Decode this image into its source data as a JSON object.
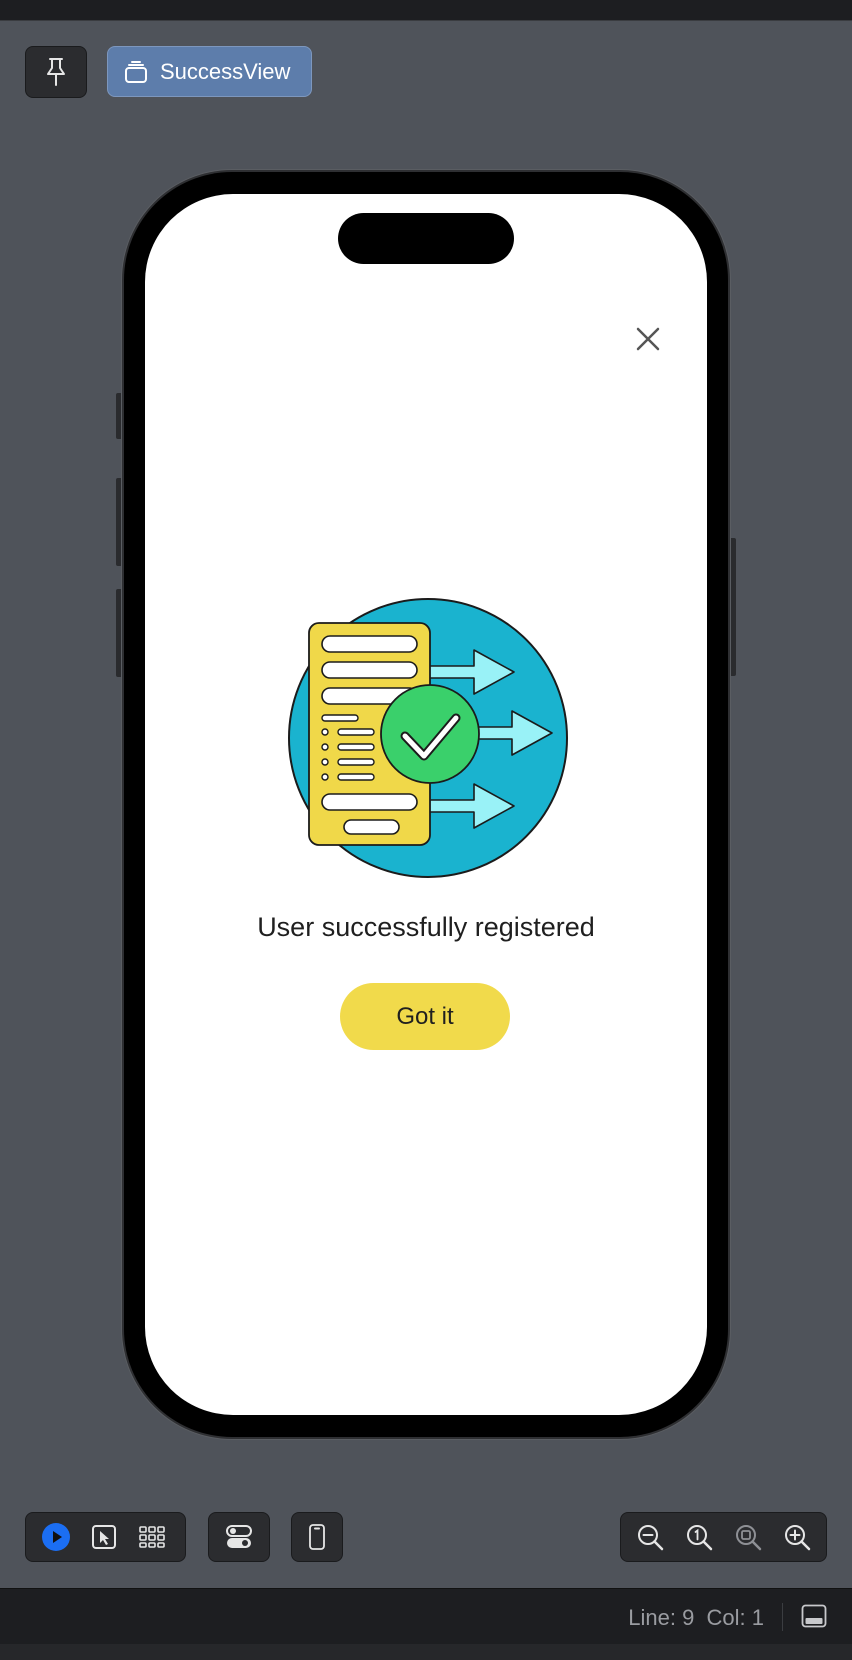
{
  "toolbar": {
    "pin": {
      "icon": "pin-icon"
    },
    "view_button": {
      "label": "SuccessView",
      "icon": "stack-icon"
    }
  },
  "preview": {
    "close_icon": "close-icon",
    "illustration": "document-checkmark-illustration",
    "message": "User successfully registered",
    "button_label": "Got it",
    "colors": {
      "button": "#f1da4b",
      "circle": "#1ab3cf",
      "arrow": "#99f2f7",
      "document": "#f0d849",
      "check": "#3ad06b"
    }
  },
  "bottom_toolbar": {
    "left_group": [
      "play-icon",
      "select-icon",
      "grid-icon"
    ],
    "middle_group": [
      "toggles-icon"
    ],
    "device_group": [
      "device-icon"
    ],
    "zoom_group": [
      "zoom-out-icon",
      "zoom-actual-icon",
      "zoom-fit-icon",
      "zoom-in-icon"
    ]
  },
  "status": {
    "position": "Line: 9  Col: 1",
    "panel_icon": "panel-toggle-icon"
  }
}
